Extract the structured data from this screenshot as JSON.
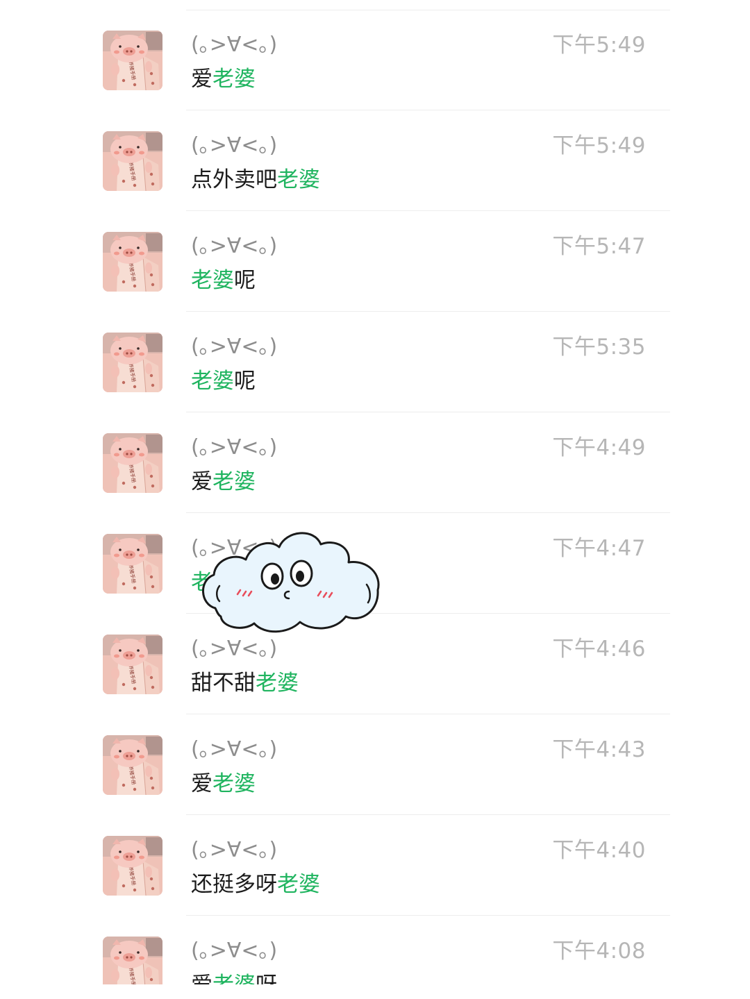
{
  "search_results": [
    {
      "name": "(｡>∀<｡)",
      "time": "下午5:49",
      "message": [
        {
          "text": "爱",
          "hl": false
        },
        {
          "text": "老婆",
          "hl": true
        }
      ]
    },
    {
      "name": "(｡>∀<｡)",
      "time": "下午5:49",
      "message": [
        {
          "text": "点外卖吧",
          "hl": false
        },
        {
          "text": "老婆",
          "hl": true
        }
      ]
    },
    {
      "name": "(｡>∀<｡)",
      "time": "下午5:47",
      "message": [
        {
          "text": "老婆",
          "hl": true
        },
        {
          "text": "呢",
          "hl": false
        }
      ]
    },
    {
      "name": "(｡>∀<｡)",
      "time": "下午5:35",
      "message": [
        {
          "text": "老婆",
          "hl": true
        },
        {
          "text": "呢",
          "hl": false
        }
      ]
    },
    {
      "name": "(｡>∀<｡)",
      "time": "下午4:49",
      "message": [
        {
          "text": "爱",
          "hl": false
        },
        {
          "text": "老婆",
          "hl": true
        }
      ]
    },
    {
      "name": "(｡>∀<｡)",
      "time": "下午4:47",
      "message": [
        {
          "text": "老",
          "hl": true
        }
      ]
    },
    {
      "name": "(｡>∀<｡)",
      "time": "下午4:46",
      "message": [
        {
          "text": "甜不甜",
          "hl": false
        },
        {
          "text": "老婆",
          "hl": true
        }
      ]
    },
    {
      "name": "(｡>∀<｡)",
      "time": "下午4:43",
      "message": [
        {
          "text": "爱",
          "hl": false
        },
        {
          "text": "老婆",
          "hl": true
        }
      ]
    },
    {
      "name": "(｡>∀<｡)",
      "time": "下午4:40",
      "message": [
        {
          "text": "还挺多呀",
          "hl": false
        },
        {
          "text": "老婆",
          "hl": true
        }
      ]
    },
    {
      "name": "(｡>∀<｡)",
      "time": "下午4:08",
      "message": [
        {
          "text": "爱",
          "hl": false
        },
        {
          "text": "老婆",
          "hl": true
        },
        {
          "text": "呀",
          "hl": false
        }
      ]
    }
  ],
  "avatar": {
    "icon": "pig-avatar-icon",
    "book_text": "养猪手册"
  },
  "sticker": {
    "icon": "cloud-sticker-icon"
  },
  "colors": {
    "highlight": "#1fb45f",
    "name": "#8d8d8d",
    "time": "#b6b6b6",
    "message": "#1c1c1c",
    "divider": "#ededed"
  }
}
